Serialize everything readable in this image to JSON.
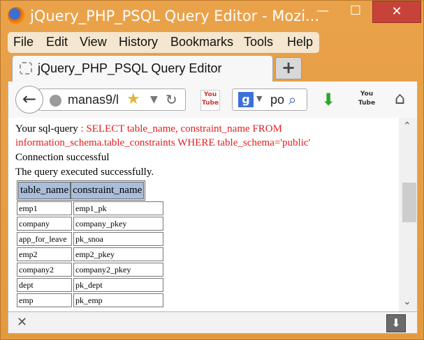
{
  "window": {
    "title": "jQuery_PHP_PSQL Query Editor - Mozi...",
    "min_glyph": "—",
    "max_glyph": "☐",
    "close_glyph": "✕"
  },
  "menu": [
    "File",
    "Edit",
    "View",
    "History",
    "Bookmarks",
    "Tools",
    "Help"
  ],
  "tab": {
    "title": "jQuery_PHP_PSQL Query Editor",
    "new_tab": "+"
  },
  "nav": {
    "url": "manas9/l",
    "search_text": "po",
    "search_engine_letter": "g",
    "yt1_text": "You Tube",
    "yt2_text": "You Tube"
  },
  "content": {
    "query_label": "Your sql-query",
    "query_sep": " : ",
    "query_line1": "SELECT table_name, constraint_name FROM",
    "query_line2": "information_schema.table_constraints WHERE table_schema='public'",
    "status1": "Connection successful",
    "status2": "The query executed successfully.",
    "columns": [
      "table_name",
      "constraint_name"
    ],
    "rows": [
      [
        "emp1",
        "emp1_pk"
      ],
      [
        "company",
        "company_pkey"
      ],
      [
        "app_for_leave",
        "pk_snoa"
      ],
      [
        "emp2",
        "emp2_pkey"
      ],
      [
        "company2",
        "company2_pkey"
      ],
      [
        "dept",
        "pk_dept"
      ],
      [
        "emp",
        "pk_emp"
      ]
    ]
  },
  "colors": {
    "accent": "#e8a248",
    "query_red": "#e51c1c",
    "header_bg": "#aabedb"
  },
  "icons": [
    "firefox-logo-icon",
    "back-arrow-icon",
    "globe-icon",
    "star-icon",
    "reload-icon",
    "youtube-icon",
    "google-icon",
    "search-icon",
    "download-icon",
    "home-icon",
    "close-icon",
    "scroll-up-icon",
    "scroll-down-icon"
  ]
}
